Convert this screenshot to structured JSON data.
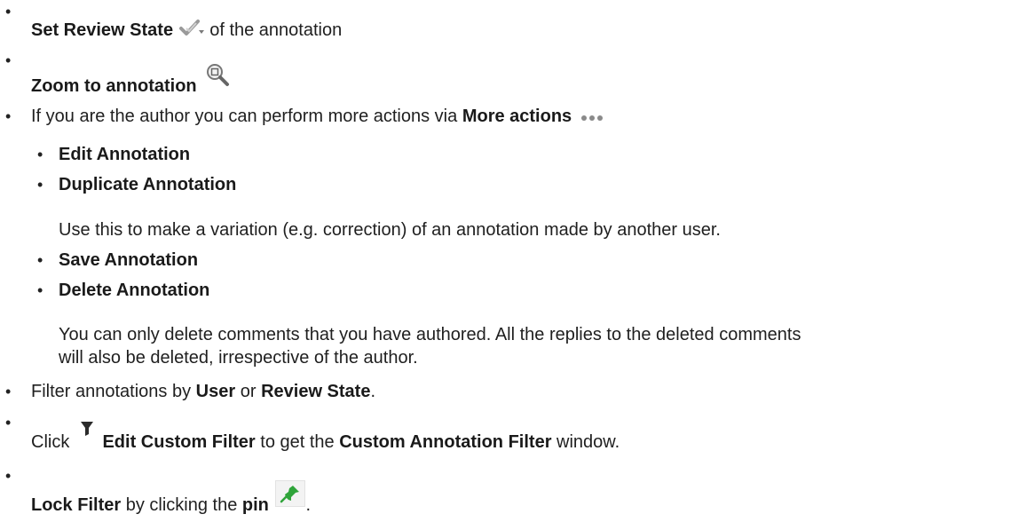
{
  "items": {
    "review": {
      "label": "Set Review State",
      "after": "of the annotation"
    },
    "zoom": {
      "label": "Zoom to annotation"
    },
    "author": {
      "before": "If you are the author you can perform more actions via",
      "label": "More actions"
    },
    "sub": {
      "edit": "Edit Annotation",
      "duplicate": "Duplicate Annotation",
      "duplicate_desc": "Use this to make a variation (e.g. correction) of an annotation made by another user.",
      "save": "Save Annotation",
      "delete": "Delete Annotation",
      "delete_desc_1": "You can only delete comments that you have authored. All the replies to the deleted comments",
      "delete_desc_2": "will also be deleted, irrespective of the author."
    },
    "filter": {
      "before": "Filter annotations by",
      "user": "User",
      "or": "or",
      "state": "Review State",
      "end": "."
    },
    "custom": {
      "before": "Click",
      "label": "Edit Custom Filter",
      "mid": "to get the",
      "window": "Custom Annotation Filter",
      "after": "window."
    },
    "lock": {
      "label": "Lock Filter",
      "mid": "by clicking the",
      "pin": "pin",
      "end": "."
    }
  },
  "icons": [
    "checkmark-dropdown-icon",
    "zoom-magnifier-icon",
    "more-actions-dots-icon",
    "filter-funnel-icon",
    "pin-icon"
  ],
  "colors": {
    "text": "#1f1f1f",
    "pin": "#2fa43a",
    "funnel": "#2b2b2b"
  }
}
